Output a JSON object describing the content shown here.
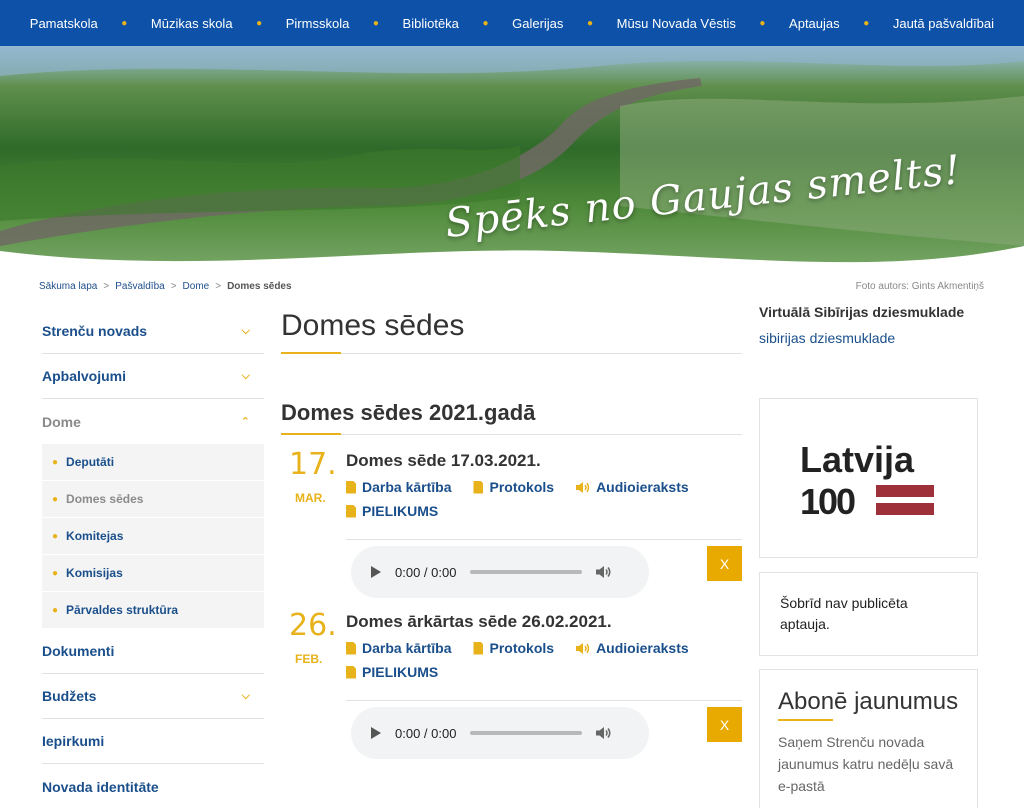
{
  "nav": {
    "items": [
      "Pamatskola",
      "Mūzikas skola",
      "Pirmsskola",
      "Bibliotēka",
      "Galerijas",
      "Mūsu Novada Vēstis",
      "Aptaujas",
      "Jautā pašvaldībai"
    ]
  },
  "hero": {
    "slogan": "Spēks no Gaujas smelts!"
  },
  "breadcrumb": {
    "items": [
      "Sākuma lapa",
      "Pašvaldība",
      "Dome"
    ],
    "current": "Domes sēdes",
    "separator": ">"
  },
  "photo_credit": "Foto autors: Gints Akmentiņš",
  "sidebar": {
    "items": [
      {
        "label": "Strenču novads",
        "has_children": true
      },
      {
        "label": "Apbalvojumi",
        "has_children": true
      },
      {
        "label": "Dome",
        "expanded": true
      },
      {
        "label": "Dokumenti"
      },
      {
        "label": "Budžets",
        "has_children": true
      },
      {
        "label": "Iepirkumi"
      },
      {
        "label": "Novada identitāte"
      }
    ],
    "submenu": [
      "Deputāti",
      "Domes sēdes",
      "Komitejas",
      "Komisijas",
      "Pārvaldes struktūra"
    ]
  },
  "main": {
    "title": "Domes sēdes",
    "section": "Domes sēdes 2021.gadā",
    "entries": [
      {
        "day": "17.",
        "month": "MAR.",
        "title": "Domes sēde 17.03.2021.",
        "links": [
          "Darba kārtība",
          "Protokols",
          "Audioieraksts",
          "PIELIKUMS"
        ],
        "player_time": "0:00 / 0:00",
        "close": "X"
      },
      {
        "day": "26.",
        "month": "FEB.",
        "title": "Domes ārkārtas sēde 26.02.2021.",
        "links": [
          "Darba kārtība",
          "Protokols",
          "Audioieraksts",
          "PIELIKUMS"
        ],
        "player_time": "0:00 / 0:00",
        "close": "X"
      }
    ]
  },
  "right": {
    "heading": "Virtuālā Sibīrijas dziesmuklade",
    "link": "sibirijas dziesmuklade",
    "logo": {
      "word": "Latvija",
      "number": "100"
    },
    "poll_text": "Šobrīd nav publicēta aptauja.",
    "subscribe_title": "Abonē jaunumus",
    "subscribe_text": "Saņem Strenču novada jaunumus katru nedēļu savā e-pastā"
  },
  "colors": {
    "nav_blue": "#0d52a8",
    "accent": "#e8b21b",
    "link_blue": "#1a4f8b"
  }
}
